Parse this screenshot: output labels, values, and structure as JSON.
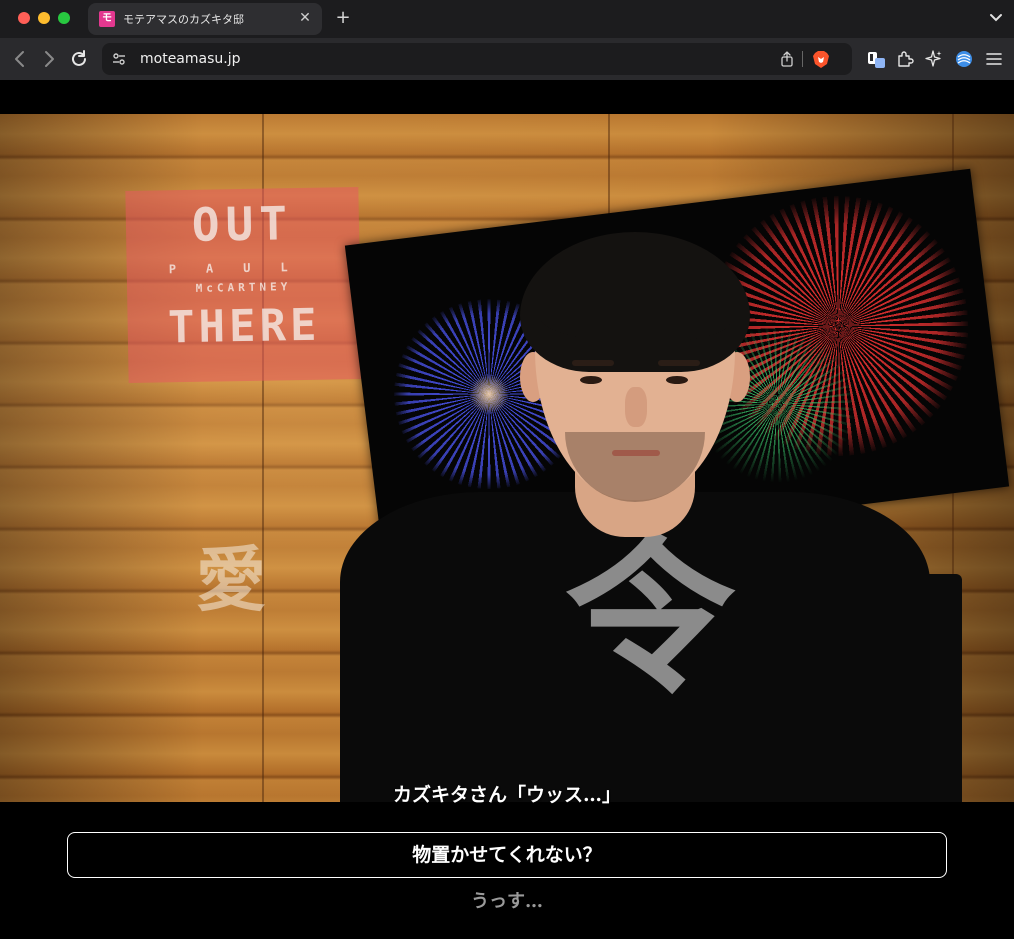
{
  "browser": {
    "tab": {
      "title": "モテアマスのカズキタ邸",
      "favicon_glyph": "モ",
      "favicon_color": "#e3388f"
    },
    "url": "moteamasu.jp",
    "icons": {
      "back": "chevron-left-icon",
      "forward": "chevron-right-icon",
      "reload": "reload-icon",
      "site_settings": "site-settings-icon",
      "share": "share-icon",
      "brave_shields": "brave-lion-icon",
      "extensions": "puzzle-icon",
      "leo_ai": "sparkle-icon",
      "wallet": "layers-icon",
      "menu": "hamburger-menu-icon"
    }
  },
  "scene": {
    "poster": {
      "line1": "OUT",
      "line2": "PAUL",
      "line3": "McCARTNEY",
      "line4": "THERE"
    },
    "wall_kanji": "愛",
    "shirt_kanji": "令"
  },
  "dialogue": {
    "line": "カズキタさん「ウッス…」"
  },
  "choices": {
    "primary": "物置かせてくれない？",
    "secondary": "うっす…"
  },
  "colors": {
    "tab_bar": "#1c1c1e",
    "toolbar": "#2a2a2d",
    "page_bg": "#000000",
    "choice_border": "#ffffff",
    "secondary_text": "#9a9a9a"
  }
}
